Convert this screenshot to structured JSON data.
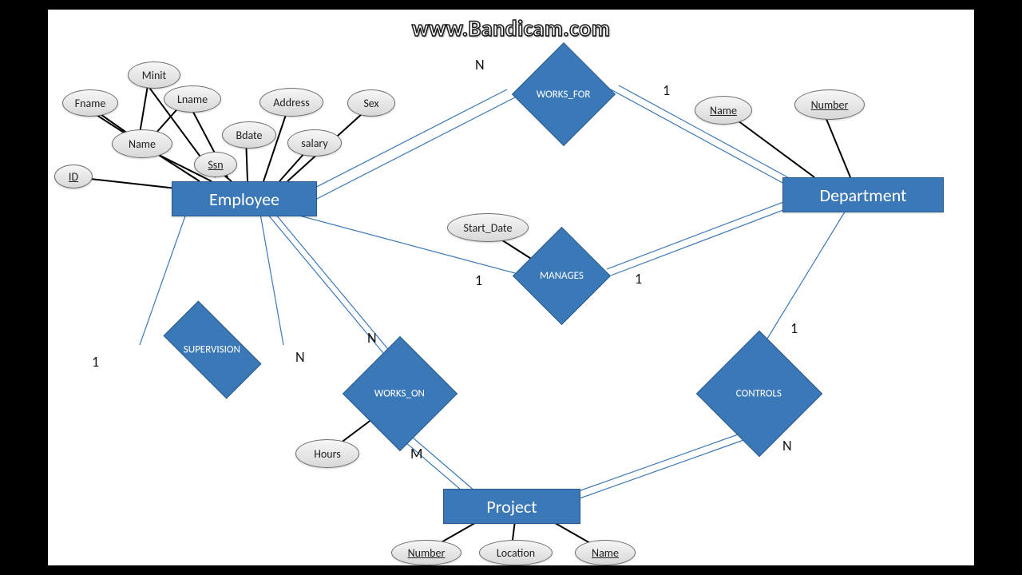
{
  "watermark": "www.Bandicam.com",
  "entities": {
    "employee": "Employee",
    "department": "Department",
    "project": "Project"
  },
  "relationships": {
    "works_for": "WORKS_FOR",
    "manages": "MANAGES",
    "supervision": "SUPERVISION",
    "works_on": "WORKS_ON",
    "controls": "CONTROLS"
  },
  "attributes": {
    "employee": {
      "minit": "Minit",
      "fname": "Fname",
      "lname": "Lname",
      "address": "Address",
      "sex": "Sex",
      "name": "Name",
      "bdate": "Bdate",
      "salary": "salary",
      "id": "ID",
      "ssn": "Ssn"
    },
    "department": {
      "name": "Name",
      "number": "Number"
    },
    "project": {
      "number": "Number",
      "location": "Location",
      "name": "Name"
    },
    "manages": {
      "start_date": "Start_Date"
    },
    "works_on": {
      "hours": "Hours"
    }
  },
  "cardinalities": {
    "works_for_left": "N",
    "works_for_right": "1",
    "manages_left": "1",
    "manages_right": "1",
    "supervision_left": "1",
    "supervision_right": "N",
    "works_on_top": "N",
    "works_on_bottom": "M",
    "controls_top": "1",
    "controls_bottom": "N"
  }
}
